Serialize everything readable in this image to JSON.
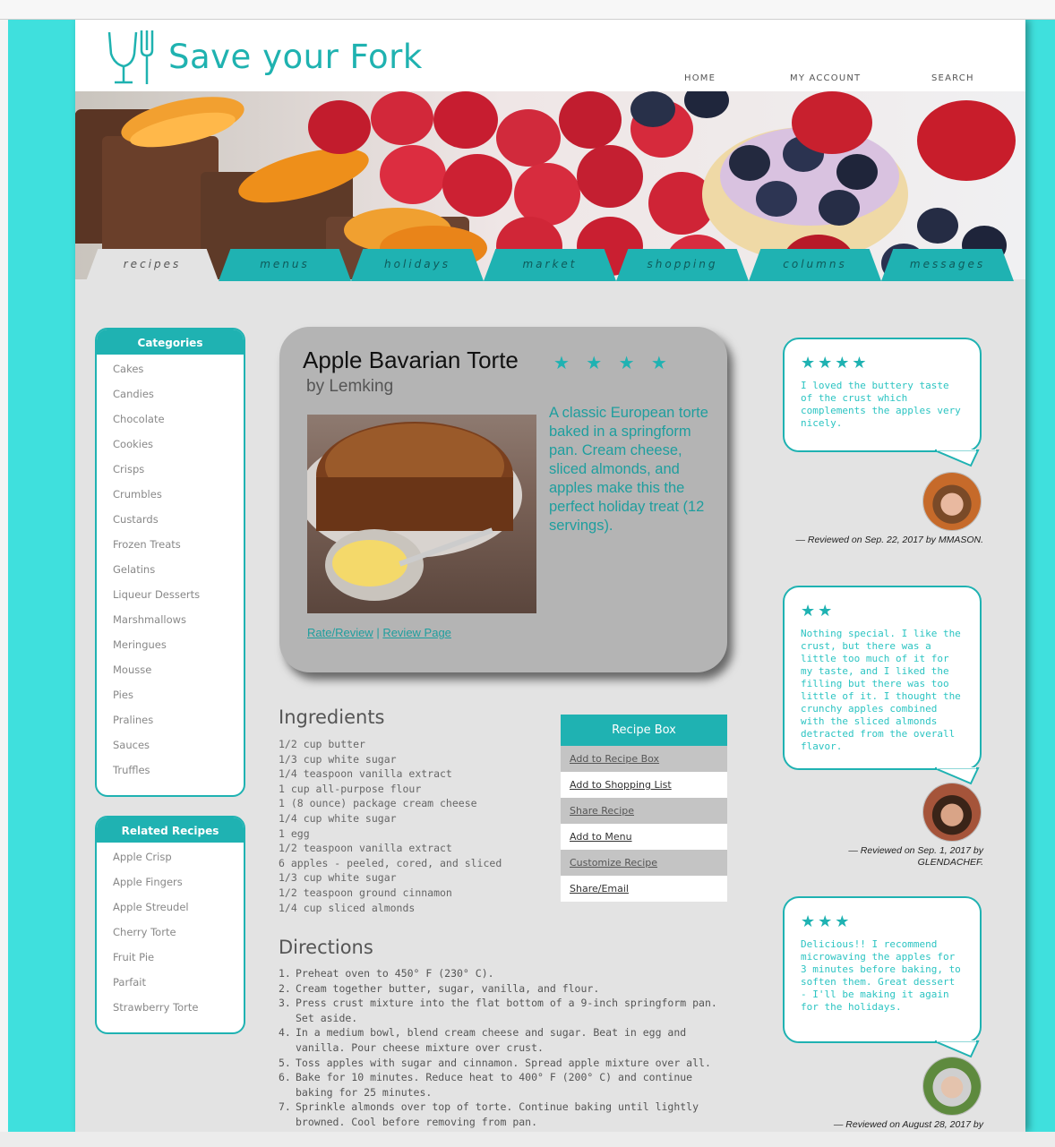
{
  "brand": {
    "name": "Save your Fork"
  },
  "topnav": [
    "HOME",
    "MY ACCOUNT",
    "SEARCH"
  ],
  "tabs": [
    "recipes",
    "menus",
    "holidays",
    "market",
    "shopping",
    "columns",
    "messages"
  ],
  "categories": {
    "title": "Categories",
    "items": [
      "Cakes",
      "Candies",
      "Chocolate",
      "Cookies",
      "Crisps",
      "Crumbles",
      "Custards",
      "Frozen Treats",
      "Gelatins",
      "Liqueur Desserts",
      "Marshmallows",
      "Meringues",
      "Mousse",
      "Pies",
      "Pralines",
      "Sauces",
      "Truffles"
    ]
  },
  "related": {
    "title": "Related Recipes",
    "items": [
      "Apple Crisp",
      "Apple Fingers",
      "Apple Streudel",
      "Cherry Torte",
      "Fruit Pie",
      "Parfait",
      "Strawberry Torte"
    ]
  },
  "recipe": {
    "title": "Apple Bavarian Torte",
    "stars": "★ ★ ★ ★",
    "rating": 3.5,
    "author": "by Lemking",
    "description": "A classic European torte baked in a springform pan. Cream cheese, sliced almonds, and apples make this the perfect holiday treat (12 servings).",
    "link_rate": "Rate/Review",
    "link_sep": " | ",
    "link_review": "Review Page"
  },
  "ingredients": {
    "title": "Ingredients",
    "items": [
      "1/2 cup butter",
      "1/3 cup white sugar",
      "1/4 teaspoon vanilla extract",
      "1 cup all-purpose flour",
      "1 (8 ounce) package cream cheese",
      "1/4 cup white sugar",
      "1 egg",
      "1/2 teaspoon vanilla extract",
      "6 apples - peeled, cored, and sliced",
      "1/3 cup white sugar",
      "1/2 teaspoon ground cinnamon",
      "1/4 cup sliced almonds"
    ]
  },
  "recipe_box": {
    "title": "Recipe Box",
    "items": [
      "Add to Recipe Box",
      "Add to Shopping List",
      "Share Recipe",
      "Add to Menu",
      "Customize Recipe",
      "Share/Email"
    ]
  },
  "directions": {
    "title": "Directions",
    "items": [
      "Preheat oven to 450° F (230° C).",
      "Cream together butter, sugar, vanilla, and flour.",
      "Press crust mixture into the flat bottom of a 9-inch springform pan. Set aside.",
      "In a medium bowl, blend cream cheese and sugar. Beat in egg and vanilla. Pour cheese mixture over crust.",
      "Toss apples with sugar and cinnamon. Spread apple mixture over all.",
      "Bake for 10 minutes. Reduce heat to 400° F (200° C) and continue baking for 25 minutes.",
      "Sprinkle almonds over top of torte. Continue baking until lightly browned. Cool before removing from pan."
    ]
  },
  "reviews": [
    {
      "stars": "★★★★",
      "text": "I loved the buttery taste of the crust which complements the apples very nicely.",
      "reviewed": "— Reviewed on Sep. 22, 2017 by MMASON."
    },
    {
      "stars": "★★",
      "text": "Nothing special. I like the crust, but there was a little too much of it for my taste, and I liked the filling but there was too little of it. I thought the crunchy apples combined with the sliced almonds detracted from the overall flavor.",
      "reviewed": "— Reviewed on Sep. 1, 2017 by GLENDACHEF."
    },
    {
      "stars": "★★★",
      "text": "Delicious!! I recommend microwaving the apples for 3 minutes before baking, to soften them. Great dessert - I'll be making it again for the holidays.",
      "reviewed": "— Reviewed on August 28, 2017 by"
    }
  ],
  "colors": {
    "accent": "#1fb2b2",
    "background": "#3fe0dd",
    "page": "#e3e3e3"
  }
}
